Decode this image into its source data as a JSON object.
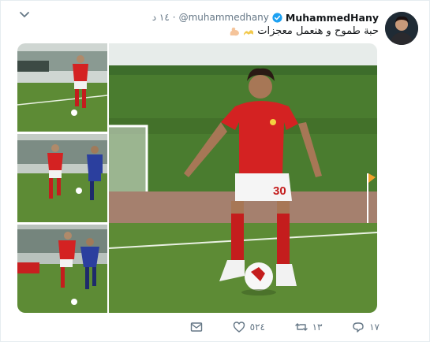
{
  "tweet": {
    "display_name": "MuhammedHany",
    "handle": "@muhammedhany",
    "time": "١٤ د",
    "dot": "·",
    "text": "حبة طموح و هنعمل معجزات",
    "emojis": [
      "wave-emoji",
      "muscle-emoji"
    ]
  },
  "actions": {
    "reply_count": "١٧",
    "retweet_count": "١٣",
    "like_count": "٥٢٤"
  },
  "colors": {
    "verified": "#1da1f2",
    "icon": "#657786",
    "shirt": "#d42222",
    "grass": "#5e8d34"
  },
  "media": {
    "main": {
      "player_number": "30"
    },
    "thumbs": [
      "player-dribbling-thumb",
      "player-duel-thumb",
      "player-tackle-thumb"
    ]
  }
}
